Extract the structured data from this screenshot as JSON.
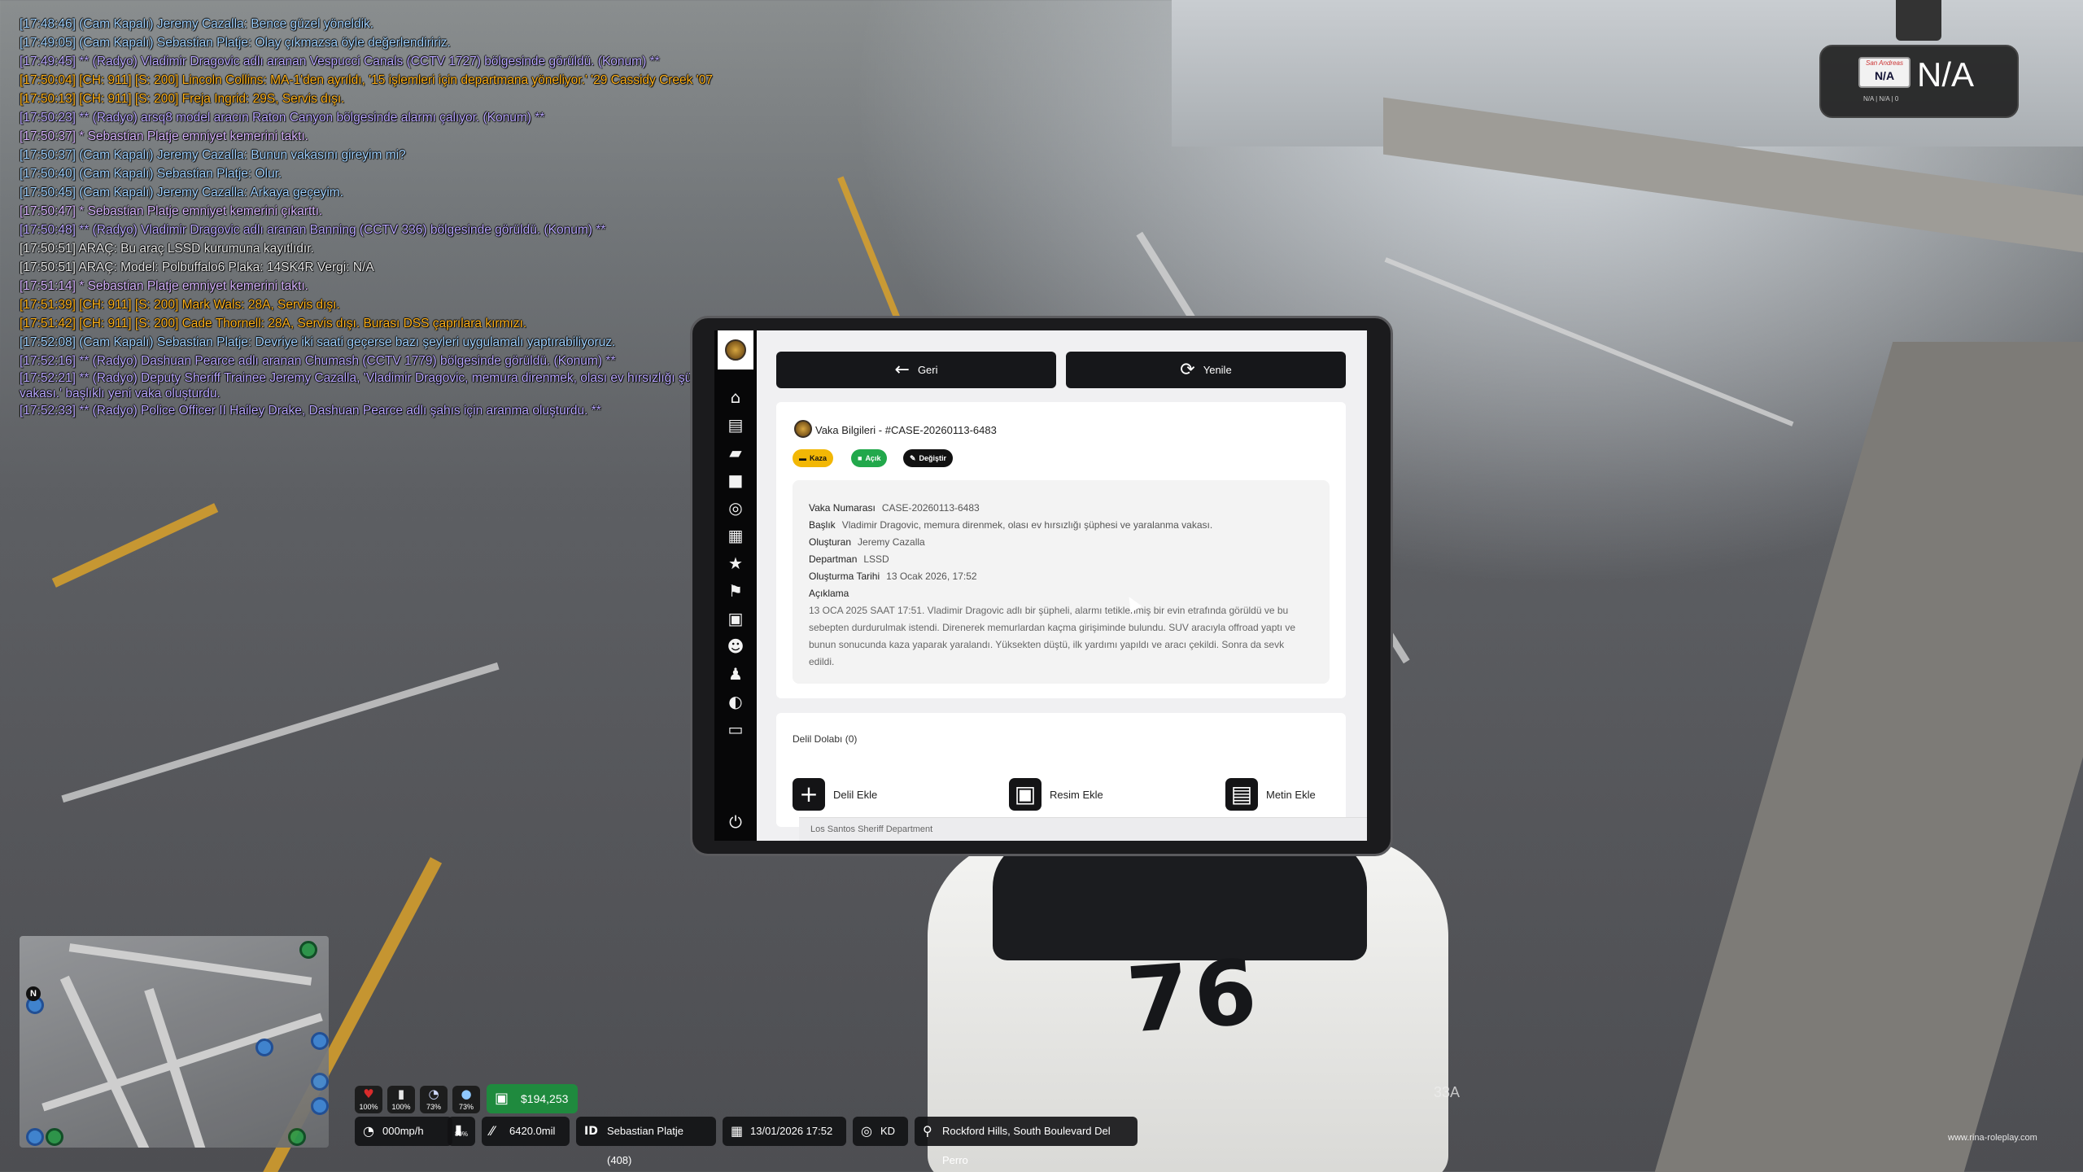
{
  "chat": [
    {
      "text": "[17:48:46] (Cam Kapalı) Jeremy Cazalla: Bence güzel yöneldik.",
      "color": "#9fd1ff"
    },
    {
      "text": "[17:49:05] (Cam Kapalı) Sebastian Platje: Olay çıkmazsa öyle değerlendiririz.",
      "color": "#9fd1ff"
    },
    {
      "text": "[17:49:45] ** (Radyo) Vladimir Dragovic adlı aranan Vespucci Canals (CCTV 1727) bölgesinde görüldü. (Konum) **",
      "color": "#b9a7ff"
    },
    {
      "text": "[17:50:04] [CH: 911] [S: 200] Lincoln Collins: MA-1'den ayrıldı, '15 işlemleri için departmana yöneliyor.' '29 Cassidy Creek '07",
      "color": "#ffb21a"
    },
    {
      "text": "[17:50:13] [CH: 911] [S: 200] Freja Ingrid: 29S, Servis dışı.",
      "color": "#ffb21a"
    },
    {
      "text": "[17:50:23] ** (Radyo) arsq8 model aracın Raton Canyon bölgesinde alarmı çalıyor. (Konum) **",
      "color": "#b9a7ff"
    },
    {
      "text": "[17:50:37] * Sebastian Platje emniyet kemerini taktı.",
      "color": "#d8b4ff"
    },
    {
      "text": "[17:50:37] (Cam Kapalı) Jeremy Cazalla: Bunun vakasını gireyim mi?",
      "color": "#9fd1ff"
    },
    {
      "text": "[17:50:40] (Cam Kapalı) Sebastian Platje: Olur.",
      "color": "#9fd1ff"
    },
    {
      "text": "[17:50:45] (Cam Kapalı) Jeremy Cazalla: Arkaya geçeyim.",
      "color": "#9fd1ff"
    },
    {
      "text": "[17:50:47] * Sebastian Platje emniyet kemerini çıkarttı.",
      "color": "#d8b4ff"
    },
    {
      "text": "[17:50:48] ** (Radyo) Vladimir Dragovic adlı aranan Banning (CCTV 336) bölgesinde görüldü. (Konum) **",
      "color": "#b9a7ff"
    },
    {
      "text": "[17:50:51] ARAÇ: Bu araç LSSD kurumuna kayıtlıdır.",
      "color": "#e6e6e6"
    },
    {
      "text": "[17:50:51] ARAÇ: Model: Polbuffalo6 Plaka: 14SK4R Vergi: N/A",
      "color": "#e6e6e6"
    },
    {
      "text": "[17:51:14] * Sebastian Platje emniyet kemerini taktı.",
      "color": "#d8b4ff"
    },
    {
      "text": "[17:51:39] [CH: 911] [S: 200] Mark Wals: 28A, Servis dışı.",
      "color": "#ffb21a"
    },
    {
      "text": "[17:51:42] [CH: 911] [S: 200] Cade Thornell: 28A, Servis dışı. Burası DSS çaprılara kırmızı.",
      "color": "#ffb21a"
    },
    {
      "text": "[17:52:08] (Cam Kapalı) Sebastian Platje: Devriye iki saati geçerse bazı şeyleri uygulamalı yaptırabiliyoruz.",
      "color": "#9fd1ff"
    },
    {
      "text": "[17:52:16] ** (Radyo) Dashuan Pearce adlı aranan Chumash (CCTV 1779) bölgesinde görüldü. (Konum) **",
      "color": "#b9a7ff"
    },
    {
      "text": "[17:52:21] ** (Radyo) Deputy Sheriff Trainee Jeremy Cazalla, 'Vladimir Dragovic, memura direnmek, olası ev hırsızlığı şüphesi ve yaralanma vakası.' başlıklı yeni vaka oluşturdu.",
      "color": "#b9a7ff"
    },
    {
      "text": "[17:52:33] ** (Radyo) Police Officer II Hailey Drake, Dashuan Pearce adlı şahıs için aranma oluşturdu. **",
      "color": "#b9a7ff"
    }
  ],
  "plate": {
    "top_text": "San Andreas",
    "plate_text": "N/A",
    "value": "N/A",
    "sub": "N/A | N/A | 0"
  },
  "tablet": {
    "back_label": "Geri",
    "refresh_label": "Yenile",
    "case_title": "Vaka Bilgileri - #CASE-20260113-6483",
    "tags": [
      {
        "label": "Kaza",
        "bg": "#f2b705",
        "fg": "#111111"
      },
      {
        "label": "Açık",
        "bg": "#22a84b",
        "fg": "#ffffff"
      },
      {
        "label": "Değiştir",
        "bg": "#111111",
        "fg": "#ffffff"
      }
    ],
    "fields": [
      {
        "key": "Vaka Numarası",
        "value": "CASE-20260113-6483"
      },
      {
        "key": "Başlık",
        "value": "Vladimir Dragovic, memura direnmek, olası ev hırsızlığı şüphesi ve yaralanma vakası."
      },
      {
        "key": "Oluşturan",
        "value": "Jeremy Cazalla"
      },
      {
        "key": "Departman",
        "value": "LSSD"
      },
      {
        "key": "Oluşturma Tarihi",
        "value": "13 Ocak 2026, 17:52"
      }
    ],
    "description_label": "Açıklama",
    "description": "13 OCA 2025 SAAT 17:51. Vladimir Dragovic adlı bir şüpheli, alarmı tetiklenmiş bir evin etrafında görüldü ve bu sebepten durdurulmak istendi. Direnerek memurlardan kaçma girişiminde bulundu. SUV aracıyla offroad yaptı ve bunun sonucunda kaza yaparak yaralandı. Yüksekten düştü, ilk yardımı yapıldı ve aracı çekildi. Sonra da sevk edildi.",
    "evidence_title": "Delil Dolabı (0)",
    "evidence_actions": [
      {
        "icon": "plus-icon",
        "glyph": "+",
        "label": "Delil Ekle"
      },
      {
        "icon": "image-icon",
        "glyph": "▣",
        "label": "Resim Ekle"
      },
      {
        "icon": "document-icon",
        "glyph": "▤",
        "label": "Metin Ekle"
      }
    ],
    "footer": "Los Santos Sheriff Department"
  },
  "hud": {
    "status": [
      {
        "icon": "heart-icon",
        "glyph": "♥",
        "value": "100%",
        "color": "#d92b2b"
      },
      {
        "icon": "armor-icon",
        "glyph": "▮",
        "value": "100%",
        "color": "#e8e8e8"
      },
      {
        "icon": "hunger-icon",
        "glyph": "◔",
        "value": "73%",
        "color": "#cfd8ff"
      },
      {
        "icon": "thirst-icon",
        "glyph": "●",
        "value": "73%",
        "color": "#8fc8ff"
      }
    ],
    "money": "$194,253",
    "speed": "000mp/h",
    "fuel": "80%",
    "odometer": "6420.0mil",
    "player": "Sebastian Platje (408)",
    "datetime": "13/01/2026 17:52",
    "direction": "KD",
    "location": "Rockford Hills, South Boulevard Del Perro"
  },
  "car_number": "76",
  "zone_label": "33A",
  "watermark": "www.rina-roleplay.com"
}
